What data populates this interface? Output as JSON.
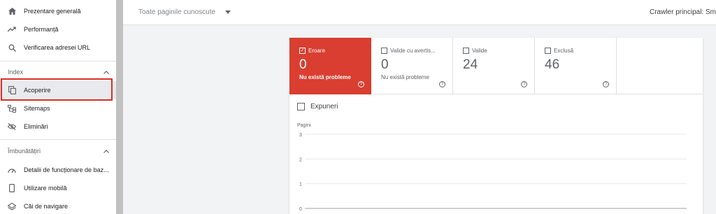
{
  "sidebar": {
    "items_top": [
      {
        "label": "Prezentare generală",
        "icon": "home-icon"
      },
      {
        "label": "Performanță",
        "icon": "trending-icon"
      },
      {
        "label": "Verificarea adresei URL",
        "icon": "search-icon"
      }
    ],
    "section_index": "Index",
    "items_index": [
      {
        "label": "Acoperire",
        "icon": "copy-icon"
      },
      {
        "label": "Sitemaps",
        "icon": "sitemap-icon"
      },
      {
        "label": "Eliminări",
        "icon": "eye-off-icon"
      }
    ],
    "section_improvements": "Îmbunătățiri",
    "items_improvements": [
      {
        "label": "Detalii de funcționare de baz...",
        "icon": "speed-icon"
      },
      {
        "label": "Utilizare mobilă",
        "icon": "phone-icon"
      },
      {
        "label": "Căi de navigare",
        "icon": "layers-icon"
      }
    ]
  },
  "topbar": {
    "filter_label": "Toate paginile cunoscute",
    "crawler_label": "Crawler principal: Sm"
  },
  "tiles": [
    {
      "label": "Eroare",
      "value": "0",
      "sub": "Nu există probleme",
      "checked": true
    },
    {
      "label": "Valide cu avertis...",
      "value": "0",
      "sub": "Nu există probleme",
      "checked": false
    },
    {
      "label": "Valide",
      "value": "24",
      "sub": "",
      "checked": false
    },
    {
      "label": "Exclusă",
      "value": "46",
      "sub": "",
      "checked": false
    }
  ],
  "expuneri_label": "Expuneri",
  "colors": {
    "error": "#d93e31",
    "highlight": "#d93025"
  },
  "chart_data": {
    "type": "line",
    "ylabel": "Pagini",
    "yticks": [
      "3",
      "2",
      "1",
      "0"
    ],
    "ylim": [
      0,
      3
    ],
    "series": [],
    "grid": true
  }
}
